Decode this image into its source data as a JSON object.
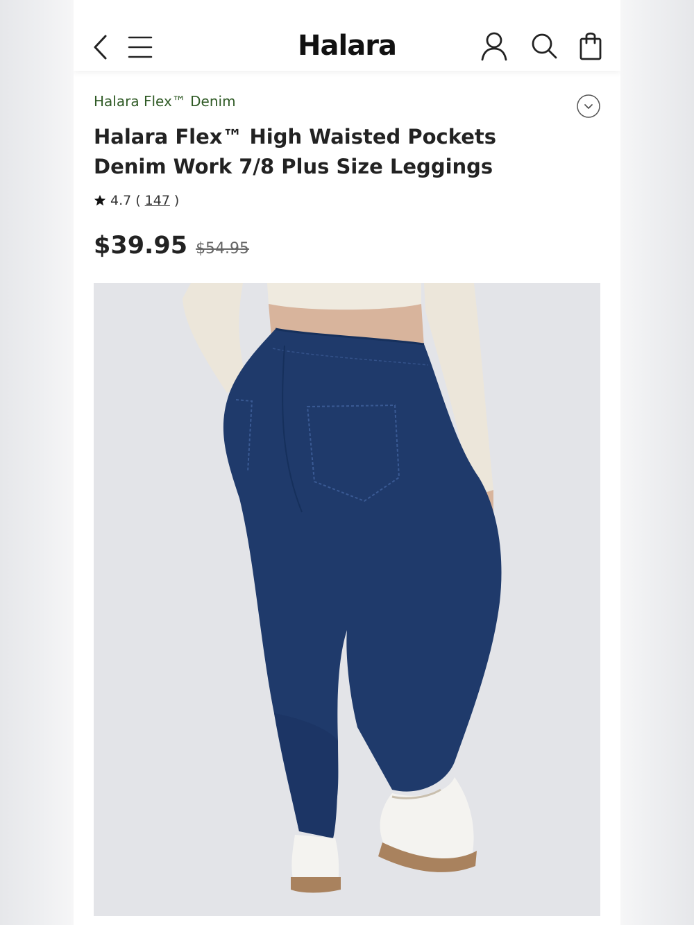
{
  "header": {
    "brand": "Halara",
    "icons": [
      "back-arrow-icon",
      "menu-icon",
      "account-icon",
      "search-icon",
      "shopping-bag-icon"
    ]
  },
  "product": {
    "collection": "Halara Flex™ Denim",
    "title": "Halara Flex™ High Waisted Pockets Denim Work 7/8 Plus Size Leggings",
    "rating": "4.7",
    "review_count": "147",
    "price_sale": "$39.95",
    "price_original": "$54.95"
  },
  "colors": {
    "collection_text": "#2f5a25",
    "denim": "#1f3a6b",
    "image_background": "#e3e4e8"
  }
}
